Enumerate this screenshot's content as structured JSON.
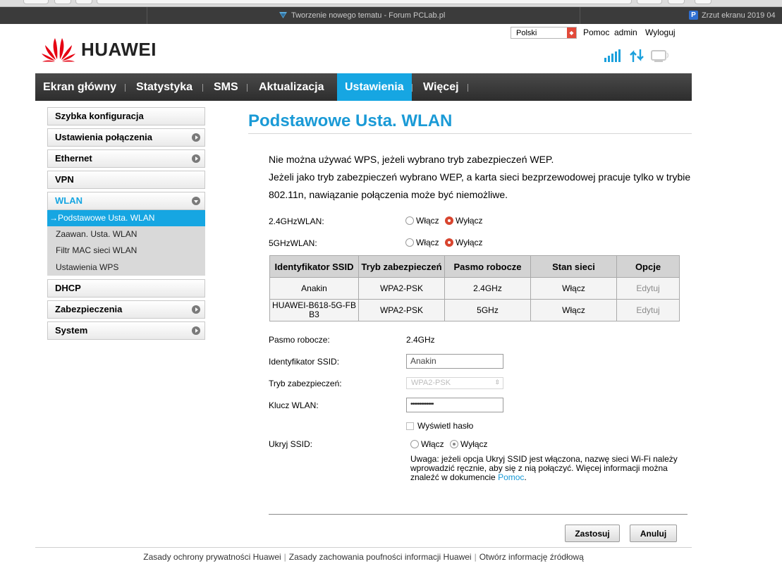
{
  "browser": {
    "active_tab_title": "Tworzenie nowego tematu - Forum PCLab.pl",
    "right_tab_title": "Zrzut ekranu 2019 04"
  },
  "header": {
    "language": "Polski",
    "help": "Pomoc",
    "user": "admin",
    "logout": "Wyloguj",
    "logo_text": "HUAWEI"
  },
  "nav": {
    "items": [
      {
        "label": "Ekran główny"
      },
      {
        "label": "Statystyka"
      },
      {
        "label": "SMS"
      },
      {
        "label": "Aktualizacja"
      },
      {
        "label": "Ustawienia"
      },
      {
        "label": "Więcej"
      }
    ],
    "active": "Ustawienia"
  },
  "sidebar": {
    "items": [
      {
        "label": "Szybka konfiguracja"
      },
      {
        "label": "Ustawienia połączenia"
      },
      {
        "label": "Ethernet"
      },
      {
        "label": "VPN"
      },
      {
        "label": "WLAN"
      },
      {
        "label": "DHCP"
      },
      {
        "label": "Zabezpieczenia"
      },
      {
        "label": "System"
      }
    ],
    "wlan_sub": [
      {
        "label": "→Podstawowe Usta. WLAN"
      },
      {
        "label": "Zaawan. Usta. WLAN"
      },
      {
        "label": "Filtr MAC sieci WLAN"
      },
      {
        "label": "Ustawienia WPS"
      }
    ]
  },
  "main": {
    "title": "Podstawowe Usta. WLAN",
    "info": [
      "Nie można używać WPS, jeżeli wybrano tryb zabezpieczeń WEP.",
      "Jeżeli jako tryb zabezpieczeń wybrano WEP, a karta sieci bezprzewodowej pracuje tylko w trybie",
      "802.11n, nawiązanie połączenia może być niemożliwe."
    ],
    "wlan24": {
      "label": "2.4GHzWLAN:",
      "on": "Włącz",
      "off": "Wyłącz",
      "selected": "Wyłącz"
    },
    "wlan5": {
      "label": "5GHzWLAN:",
      "on": "Włącz",
      "off": "Wyłącz",
      "selected": "Wyłącz"
    },
    "table": {
      "headers": [
        "Identyfikator SSID",
        "Tryb zabezpieczeń",
        "Pasmo robocze",
        "Stan sieci",
        "Opcje"
      ],
      "rows": [
        {
          "ssid": "Anakin",
          "mode": "WPA2-PSK",
          "band": "2.4GHz",
          "state": "Włącz",
          "action": "Edytuj"
        },
        {
          "ssid": "HUAWEI-B618-5G-FB B3",
          "mode": "WPA2-PSK",
          "band": "5GHz",
          "state": "Włącz",
          "action": "Edytuj"
        }
      ]
    },
    "form": {
      "band_label": "Pasmo robocze:",
      "band_value": "2.4GHz",
      "ssid_label": "Identyfikator SSID:",
      "ssid_value": "Anakin",
      "mode_label": "Tryb zabezpieczeń:",
      "mode_value": "WPA2-PSK",
      "key_label": "Klucz WLAN:",
      "key_value": "•••••••••••••",
      "show_password": "Wyświetl hasło",
      "hide_label": "Ukryj SSID:",
      "hide_on": "Włącz",
      "hide_off": "Wyłącz",
      "hide_selected": "Wyłącz",
      "note_text": "Uwaga: jeżeli opcja Ukryj SSID jest włączona, nazwę sieci Wi-Fi należy wprowadzić ręcznie, aby się z nią połączyć. Więcej informacji można znaleźć w dokumencie ",
      "note_link": "Pomoc",
      "note_end": "."
    },
    "buttons": {
      "apply": "Zastosuj",
      "cancel": "Anuluj"
    }
  },
  "footer": {
    "links": [
      "Zasady ochrony prywatności Huawei",
      "Zasady zachowania poufności informacji Huawei",
      "Otwórz informację źródłową"
    ]
  },
  "colors": {
    "accent": "#16a6e2",
    "title": "#1a9ad6",
    "radio_selected": "#d8452f",
    "nav_bg": "#3a3a3a"
  },
  "icons": [
    "signal-icon",
    "data-transfer-icon",
    "wifi-device-icon",
    "huawei-logo"
  ]
}
